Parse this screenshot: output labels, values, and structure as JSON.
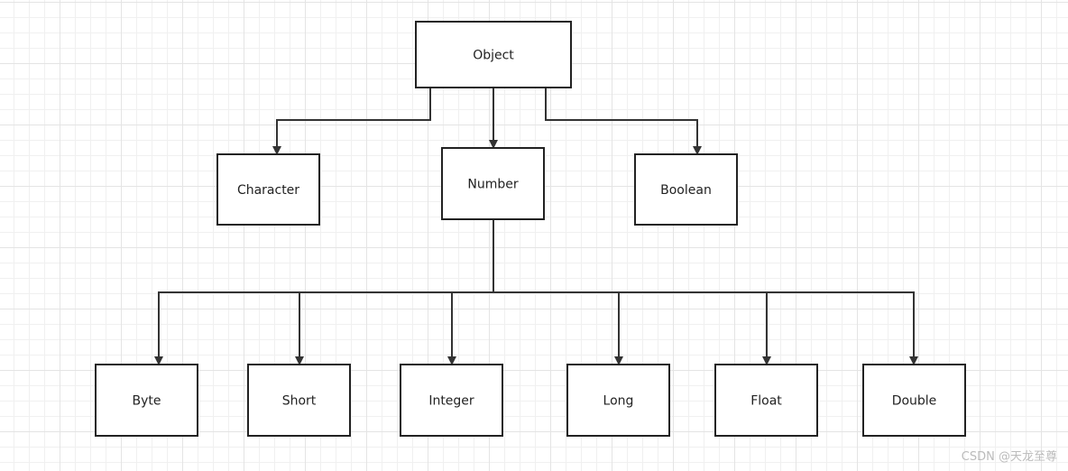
{
  "nodes": {
    "object": "Object",
    "character": "Character",
    "number": "Number",
    "boolean": "Boolean",
    "byte": "Byte",
    "short": "Short",
    "integer": "Integer",
    "long": "Long",
    "float": "Float",
    "double": "Double"
  },
  "edges": [
    [
      "object",
      "character"
    ],
    [
      "object",
      "number"
    ],
    [
      "object",
      "boolean"
    ],
    [
      "number",
      "byte"
    ],
    [
      "number",
      "short"
    ],
    [
      "number",
      "integer"
    ],
    [
      "number",
      "long"
    ],
    [
      "number",
      "float"
    ],
    [
      "number",
      "double"
    ]
  ],
  "watermark": "CSDN @天龙至尊"
}
